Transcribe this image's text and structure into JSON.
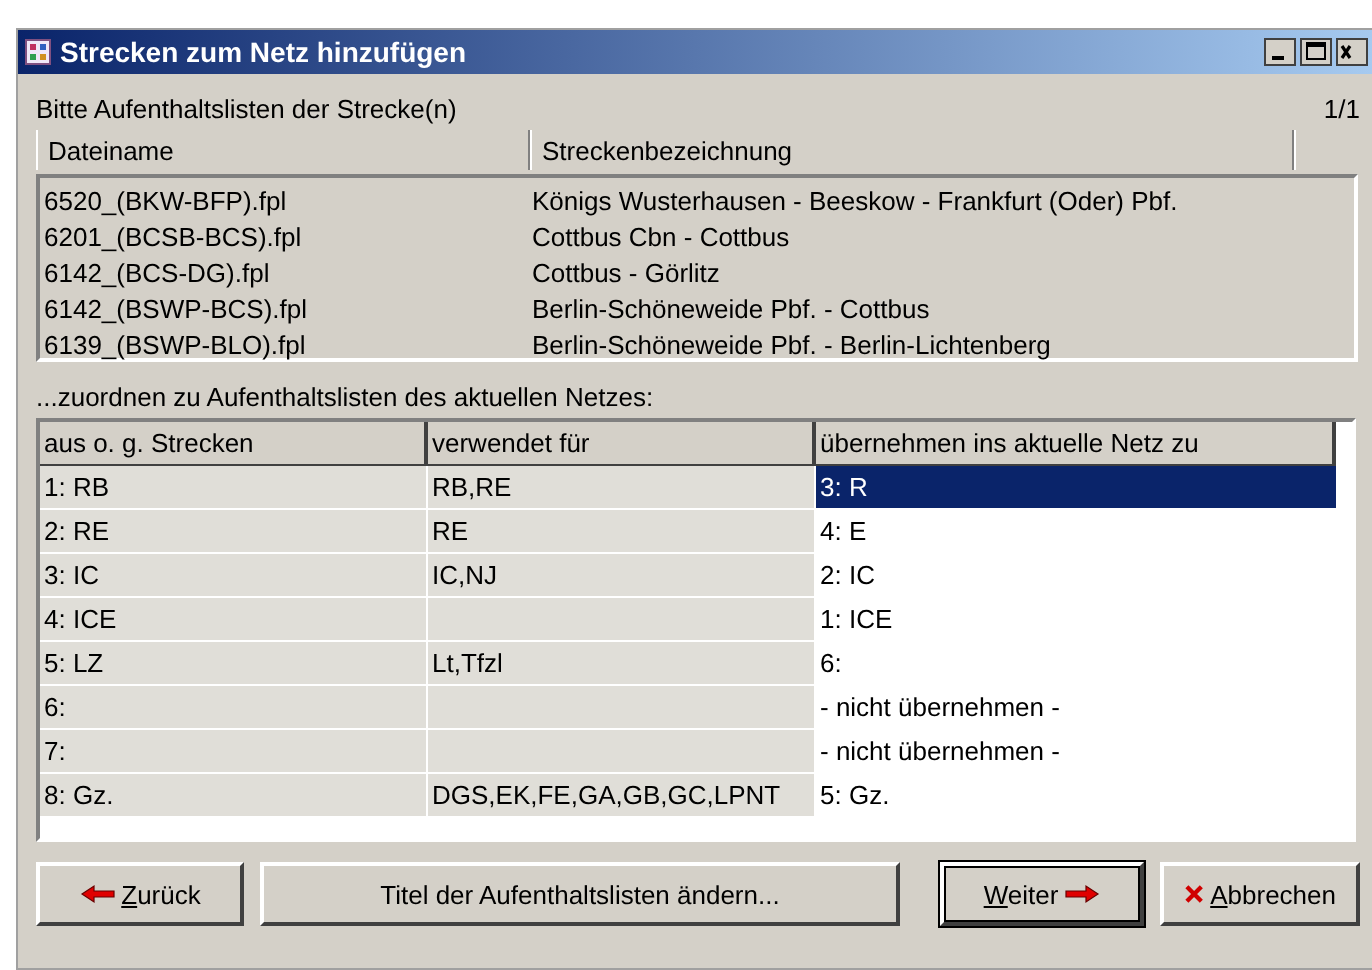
{
  "window": {
    "title": "Strecken zum Netz hinzufügen"
  },
  "prompt": "Bitte Aufenthaltslisten der Strecke(n)",
  "page_counter": "1/1",
  "routes": {
    "columns": [
      "Dateiname",
      "Streckenbezeichnung"
    ],
    "rows": [
      [
        "6520_(BKW-BFP).fpl",
        "Königs Wusterhausen - Beeskow - Frankfurt (Oder) Pbf."
      ],
      [
        "6201_(BCSB-BCS).fpl",
        "Cottbus Cbn - Cottbus"
      ],
      [
        "6142_(BCS-DG).fpl",
        "Cottbus - Görlitz"
      ],
      [
        "6142_(BSWP-BCS).fpl",
        "Berlin-Schöneweide Pbf. - Cottbus"
      ],
      [
        "6139_(BSWP-BLO).fpl",
        "Berlin-Schöneweide Pbf. - Berlin-Lichtenberg"
      ]
    ]
  },
  "assign_label": "...zuordnen zu Aufenthaltslisten des aktuellen Netzes:",
  "mapping": {
    "columns": [
      "aus o. g. Strecken",
      "verwendet für",
      "übernehmen ins aktuelle Netz zu"
    ],
    "rows": [
      {
        "source": "1: RB",
        "used_for": "RB,RE",
        "target": "3: R",
        "selected": true
      },
      {
        "source": "2: RE",
        "used_for": "RE",
        "target": "4: E",
        "selected": false
      },
      {
        "source": "3: IC",
        "used_for": "IC,NJ",
        "target": "2: IC",
        "selected": false
      },
      {
        "source": "4: ICE",
        "target": "1: ICE",
        "selected": false
      },
      {
        "source": "5: LZ",
        "used_for": "Lt,Tfzl",
        "target": "6:",
        "selected": false
      },
      {
        "source": "6:",
        "target": "- nicht übernehmen -",
        "selected": false
      },
      {
        "source": "7:",
        "target": "- nicht übernehmen -",
        "selected": false
      },
      {
        "source": "8: Gz.",
        "used_for": "DGS,EK,FE,GA,GB,GC,LPNT",
        "target": "5: Gz.",
        "selected": false
      }
    ]
  },
  "buttons": [
    {
      "kind": "back",
      "label": "Zurück",
      "mnemonic": true,
      "default": false
    },
    {
      "kind": "plain",
      "label": "Titel der Aufenthaltslisten ändern...",
      "mnemonic": false,
      "default": false
    },
    {
      "kind": "next",
      "label": "Weiter",
      "mnemonic": true,
      "default": true
    },
    {
      "kind": "cancel",
      "label": "Abbrechen",
      "mnemonic": true,
      "default": false
    }
  ]
}
